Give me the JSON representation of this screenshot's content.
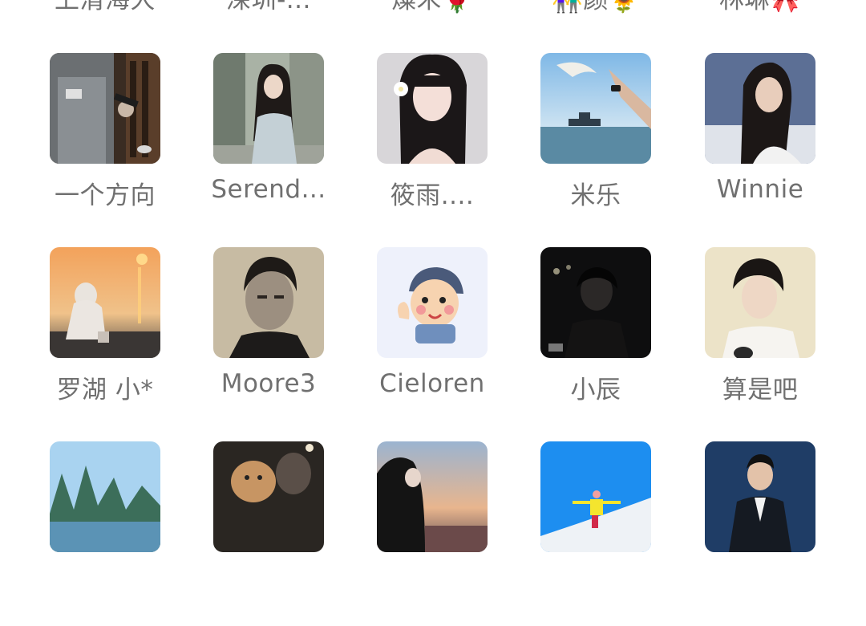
{
  "group_members": {
    "top_partial_row": [
      {
        "name": "上清海大"
      },
      {
        "name": "深圳-..."
      },
      {
        "name": "燦禾🌹"
      },
      {
        "name": "👫颜🌻"
      },
      {
        "name": "林琳🎀"
      }
    ],
    "rows": [
      [
        {
          "name": "一个方向",
          "avatar": "man-pouring-wine-photo"
        },
        {
          "name": "Serend...",
          "avatar": "woman-long-hair-street-photo"
        },
        {
          "name": "筱雨....",
          "avatar": "girl-with-flower-photo"
        },
        {
          "name": "米乐",
          "avatar": "sea-and-seagull-photo"
        },
        {
          "name": "Winnie",
          "avatar": "woman-portrait-photo"
        }
      ],
      [
        {
          "name": "罗湖 小*",
          "avatar": "sunset-beach-chair-photo"
        },
        {
          "name": "Moore3",
          "avatar": "man-portrait-sepia-photo"
        },
        {
          "name": "Cieloren",
          "avatar": "cartoon-boy-sticker"
        },
        {
          "name": "小辰",
          "avatar": "dark-night-portrait-photo"
        },
        {
          "name": "算是吧",
          "avatar": "young-man-portrait-photo"
        }
      ],
      [
        {
          "name": "",
          "avatar": "karst-mountains-landscape-photo"
        },
        {
          "name": "",
          "avatar": "couple-with-cat-photo"
        },
        {
          "name": "",
          "avatar": "hooded-person-sunset-photo"
        },
        {
          "name": "",
          "avatar": "skier-on-snow-photo"
        },
        {
          "name": "",
          "avatar": "man-in-suit-photo"
        }
      ]
    ]
  }
}
